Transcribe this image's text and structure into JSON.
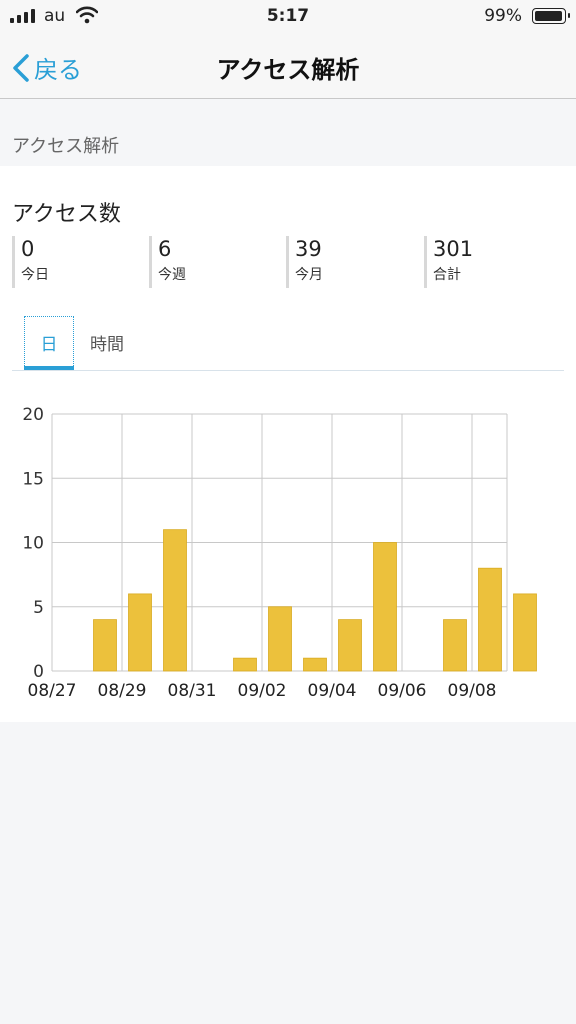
{
  "status_bar": {
    "carrier": "au",
    "time": "5:17",
    "battery": "99%",
    "battery_level": 0.99
  },
  "nav": {
    "back_label": "戻る",
    "title": "アクセス解析"
  },
  "section_label": "アクセス解析",
  "card": {
    "title": "アクセス数",
    "stats": [
      {
        "value": "0",
        "label": "今日"
      },
      {
        "value": "6",
        "label": "今週"
      },
      {
        "value": "39",
        "label": "今月"
      },
      {
        "value": "301",
        "label": "合計"
      }
    ],
    "tabs": [
      {
        "label": "日",
        "active": true
      },
      {
        "label": "時間",
        "active": false
      }
    ]
  },
  "colors": {
    "accent": "#2a9fd6",
    "bar": "#ecc13c",
    "grid": "#c8c8c8"
  },
  "chart_data": {
    "type": "bar",
    "x": [
      "08/27",
      "08/28",
      "08/29",
      "08/30",
      "08/31",
      "09/01",
      "09/02",
      "09/03",
      "09/04",
      "09/05",
      "09/06",
      "09/07",
      "09/08",
      "09/09"
    ],
    "values": [
      0,
      4,
      6,
      11,
      0,
      1,
      5,
      1,
      4,
      10,
      0,
      4,
      8,
      6
    ],
    "xtick_labels": [
      "08/27",
      "08/29",
      "08/31",
      "09/02",
      "09/04",
      "09/06",
      "09/08"
    ],
    "yticks": [
      "0",
      "5",
      "10",
      "15",
      "20"
    ],
    "ylim": [
      0,
      20
    ],
    "grid": true
  }
}
